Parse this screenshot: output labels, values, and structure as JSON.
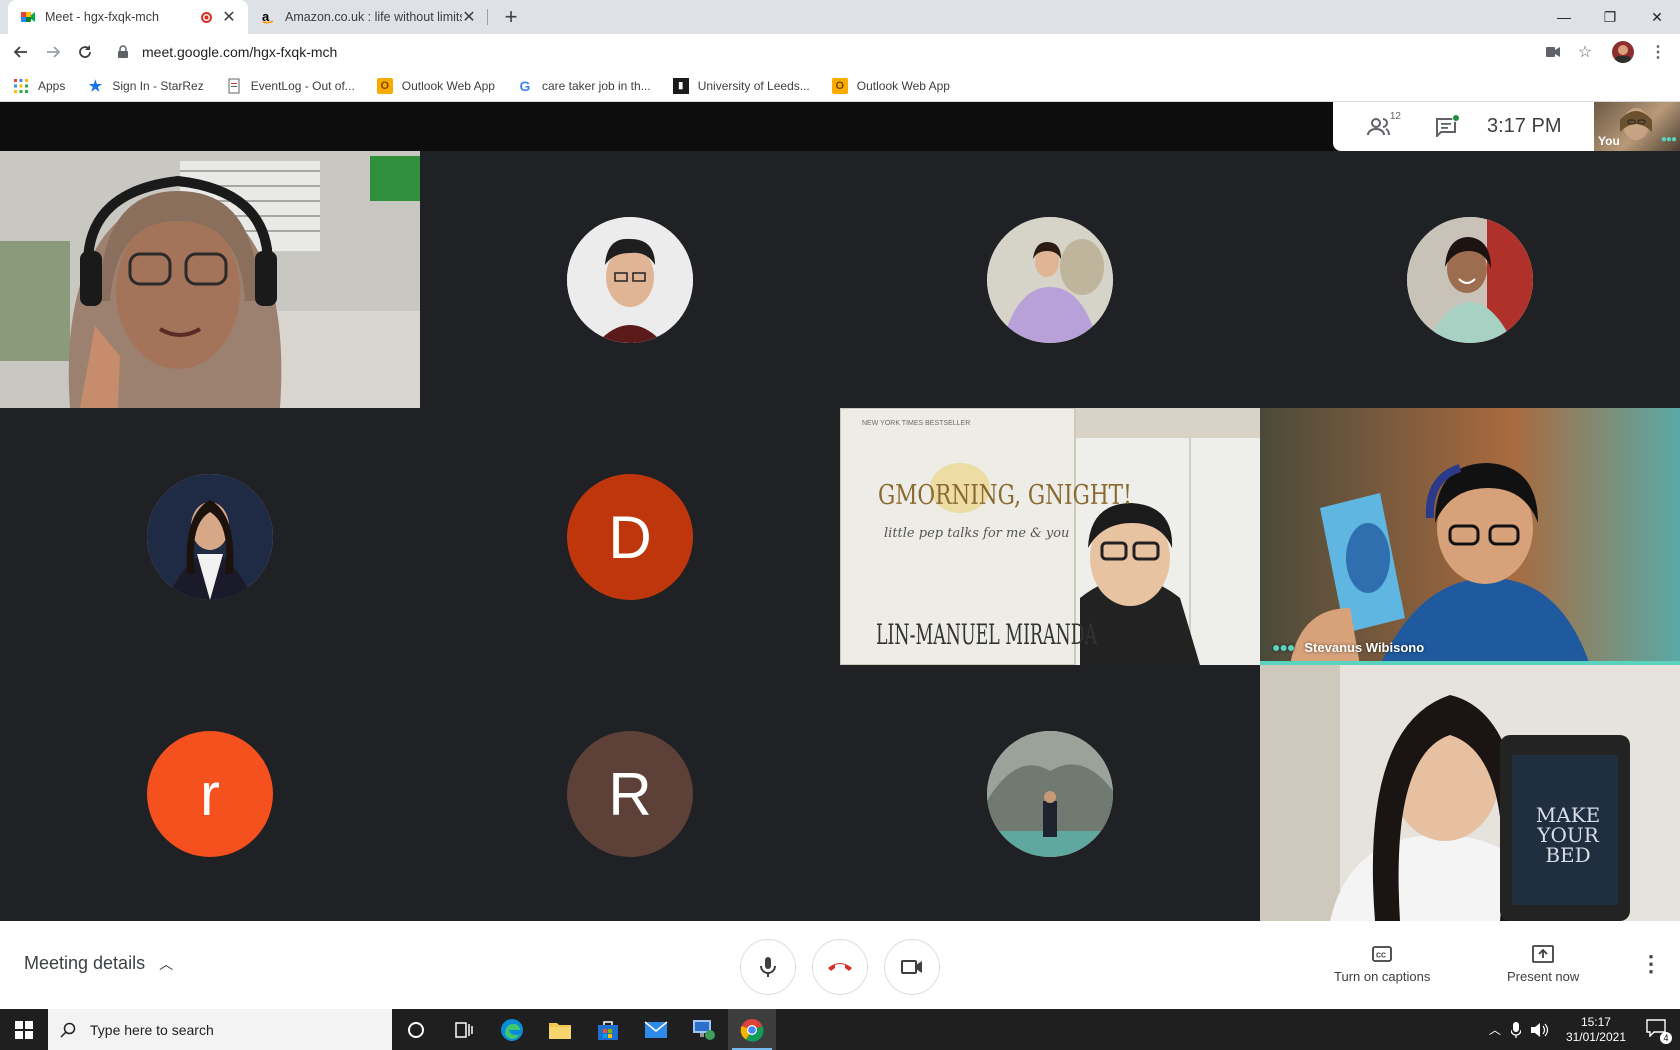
{
  "browser": {
    "tabs": [
      {
        "title": "Meet - hgx-fxqk-mch",
        "active": true
      },
      {
        "title": "Amazon.co.uk : life without limits",
        "active": false
      }
    ],
    "new_tab": "+",
    "window_controls": {
      "minimize": "—",
      "restore": "❐",
      "close": "✕"
    },
    "url": "meet.google.com/hgx-fxqk-mch",
    "bookmarks": [
      {
        "label": "Apps",
        "icon": "apps-grid-icon"
      },
      {
        "label": "Sign In - StarRez",
        "icon": "star-icon"
      },
      {
        "label": "EventLog - Out of...",
        "icon": "document-icon"
      },
      {
        "label": "Outlook Web App",
        "icon": "outlook-icon"
      },
      {
        "label": "care taker job in th...",
        "icon": "google-icon"
      },
      {
        "label": "University of Leeds...",
        "icon": "university-icon"
      },
      {
        "label": "Outlook Web App",
        "icon": "outlook-icon"
      }
    ]
  },
  "meet": {
    "participant_count": "12",
    "time": "3:17 PM",
    "self_label": "You",
    "tiles": [
      {
        "kind": "video",
        "desc": "woman-headset"
      },
      {
        "kind": "avatar-photo",
        "desc": "man-glasses"
      },
      {
        "kind": "avatar-photo",
        "desc": "woman-purple-dress"
      },
      {
        "kind": "avatar-photo",
        "desc": "woman-smiling"
      },
      {
        "kind": "avatar-photo",
        "desc": "woman-portrait"
      },
      {
        "kind": "avatar-letter",
        "letter": "D",
        "color": "#bf360c"
      },
      {
        "kind": "video",
        "desc": "book-gmorning-gnight"
      },
      {
        "kind": "video",
        "desc": "stevanus-speaking",
        "name": "Stevanus Wibisono"
      },
      {
        "kind": "avatar-letter",
        "letter": "r",
        "color": "#f4511e"
      },
      {
        "kind": "avatar-letter",
        "letter": "R",
        "color": "#5d4037"
      },
      {
        "kind": "avatar-photo",
        "desc": "man-landscape"
      },
      {
        "kind": "video",
        "desc": "woman-make-your-bed"
      }
    ],
    "book_title": "GMORNING, GNIGHT!",
    "book_subtitle": "little pep talks for me & you",
    "book_author": "LIN-MANUEL MIRANDA",
    "book_banner": "NEW YORK TIMES  BESTSELLER",
    "book2_title": "MAKE YOUR BED",
    "accent_speaking": "#5bd2c0"
  },
  "bottombar": {
    "meeting_details": "Meeting details",
    "captions_label": "Turn on captions",
    "present_label": "Present now"
  },
  "taskbar": {
    "search_placeholder": "Type here to search",
    "time": "15:17",
    "date": "31/01/2021",
    "notifications": "4"
  }
}
